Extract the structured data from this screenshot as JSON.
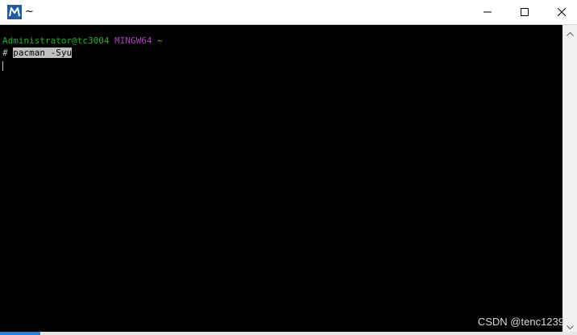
{
  "window": {
    "title": "~",
    "app_icon": "mintty-m-icon"
  },
  "controls": {
    "minimize": "minimize-icon",
    "maximize": "maximize-icon",
    "close": "close-icon"
  },
  "terminal": {
    "prompt_user": "Administrator@tc3004",
    "prompt_env": "MINGW64",
    "prompt_path": "~",
    "prompt_symbol": "#",
    "command": "pacman -Syu"
  },
  "watermark": "CSDN @tenc1239",
  "colors": {
    "background": "#000000",
    "prompt_user": "#20b020",
    "prompt_env": "#b040c0",
    "prompt_path": "#c7a000",
    "text": "#bfbfbf",
    "selection": "#c0c0c0",
    "icon": "#1f5d9e"
  }
}
